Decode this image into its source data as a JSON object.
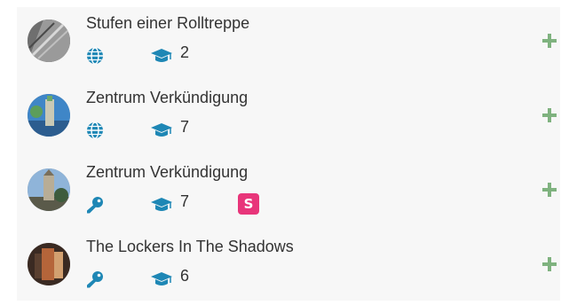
{
  "colors": {
    "icon_blue": "#1e87b5",
    "plus_green": "#7fb27f",
    "badge_pink": "#e8357a",
    "panel_bg": "#f7f7f7",
    "text": "#333333"
  },
  "items": [
    {
      "title": "Stufen einer Rolltreppe",
      "access_icon": "globe-icon",
      "count": "2",
      "badge": ""
    },
    {
      "title": "Zentrum Verkündigung",
      "access_icon": "globe-icon",
      "count": "7",
      "badge": ""
    },
    {
      "title": "Zentrum Verkündigung",
      "access_icon": "key-icon",
      "count": "7",
      "badge": "S"
    },
    {
      "title": "The Lockers In The Shadows",
      "access_icon": "key-icon",
      "count": "6",
      "badge": ""
    }
  ]
}
